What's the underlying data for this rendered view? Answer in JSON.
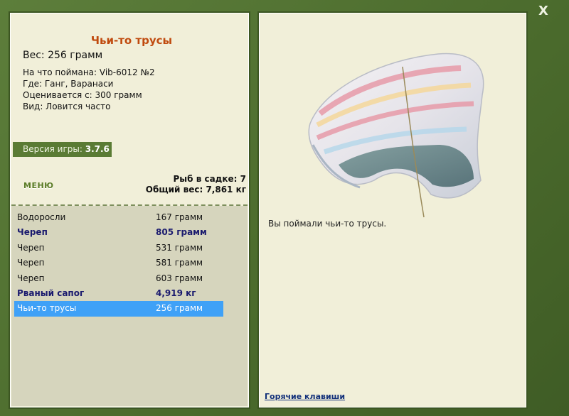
{
  "window": {
    "close_label": "X"
  },
  "catch_info": {
    "title": "Чьи-то трусы",
    "weight": "Вес: 256 грамм",
    "lure": "На что поймана: Vib-6012 №2",
    "location": "Где: Ганг, Варанаси",
    "valued_from": "Оценивается с: 300 грамм",
    "type": "Вид: Ловится часто"
  },
  "version": {
    "label": "Версия игры:",
    "value": "3.7.6"
  },
  "menu": {
    "label": "МЕНЮ"
  },
  "summary": {
    "fish_in_keepnet": "Рыб в садке: 7",
    "total_weight": "Общий вес: 7,861 кг"
  },
  "keepnet": [
    {
      "name": "Водоросли",
      "weight": "167 грамм",
      "style": "normal"
    },
    {
      "name": "Череп",
      "weight": "805 грамм",
      "style": "bold"
    },
    {
      "name": "Череп",
      "weight": "531 грамм",
      "style": "normal"
    },
    {
      "name": "Череп",
      "weight": "581 грамм",
      "style": "normal"
    },
    {
      "name": "Череп",
      "weight": "603 грамм",
      "style": "normal"
    },
    {
      "name": "Рваный сапог",
      "weight": "4,919 кг",
      "style": "bold"
    },
    {
      "name": "Чьи-то трусы",
      "weight": "256 грамм",
      "style": "selected"
    }
  ],
  "result": {
    "message": "Вы поймали чьи-то трусы.",
    "hotkeys_label": "Горячие клавиши"
  },
  "colors": {
    "frame": "#4f6f31",
    "panel": "#f1efd9",
    "title": "#c04a0e",
    "selected_row": "#3fa1f7",
    "bold_row": "#1a1a6e"
  },
  "icons": {
    "close": "close-icon",
    "catch_picture": "underwear-picture"
  }
}
